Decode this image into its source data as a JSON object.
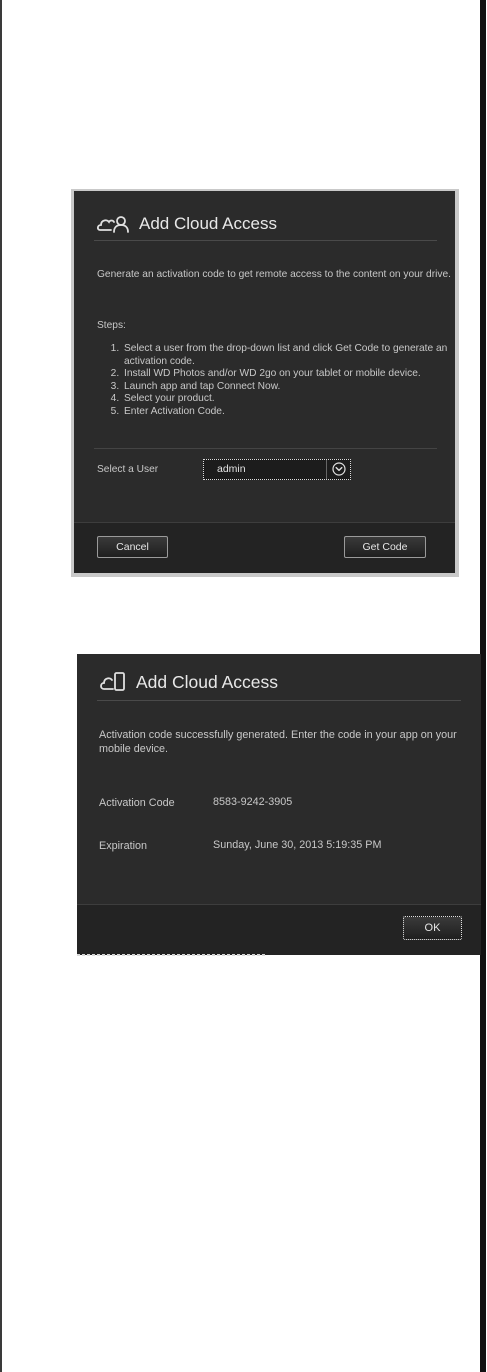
{
  "dialog1": {
    "title": "Add Cloud Access",
    "title_icon": "cloud-user-icon",
    "intro": "Generate an activation code to get remote access to the content on your drive.",
    "steps_label": "Steps:",
    "steps": [
      "Select a user from the drop-down list and click Get Code to generate an activation code.",
      "Install WD Photos and/or WD 2go on your tablet or mobile device.",
      "Launch app and tap Connect Now.",
      "Select your product.",
      "Enter Activation Code."
    ],
    "user_label": "Select a User",
    "user_value": "admin",
    "cancel_label": "Cancel",
    "getcode_label": "Get Code"
  },
  "dialog2": {
    "title": "Add Cloud Access",
    "title_icon": "cloud-mobile-icon",
    "message": "Activation code successfully generated. Enter the code in your app on your mobile device.",
    "code_label": "Activation Code",
    "code_value": "8583-9242-3905",
    "expiration_label": "Expiration",
    "expiration_value": "Sunday, June 30, 2013 5:19:35 PM",
    "ok_label": "OK"
  },
  "colors": {
    "dialog_bg": "#2b2b2b",
    "footer_bg": "#232323",
    "text": "#c8c8c8",
    "title": "#e8e8e8"
  }
}
